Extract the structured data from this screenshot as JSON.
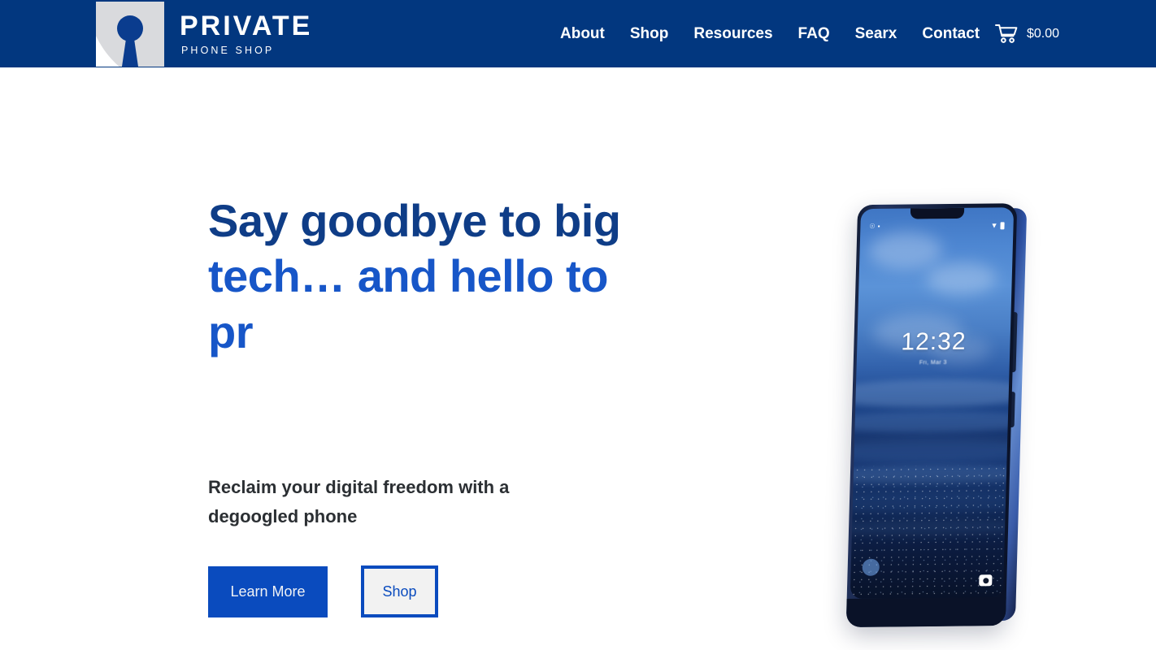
{
  "header": {
    "logo": {
      "icon": "keyhole-logo-icon",
      "title": "PRIVATE",
      "subtitle": "PHONE SHOP"
    },
    "nav": [
      {
        "label": "About"
      },
      {
        "label": "Shop"
      },
      {
        "label": "Resources"
      },
      {
        "label": "FAQ"
      },
      {
        "label": "Searx"
      },
      {
        "label": "Contact"
      }
    ],
    "cart": {
      "icon": "shopping-cart-icon",
      "total": "$0.00"
    },
    "background_color": "#02377F"
  },
  "hero": {
    "heading_line_1": "Say goodbye to big",
    "heading_line_2": "tech… and hello to pr",
    "heading_color_1": "#0F3D87",
    "heading_color_2": "#1756C8",
    "subheading": "Reclaim your digital freedom with a degoogled phone",
    "subheading_color": "#2B2F33",
    "buttons": {
      "primary_label": "Learn More",
      "primary_bg": "#0A4BBE",
      "secondary_label": "Shop",
      "secondary_bg": "#F2F2F2",
      "secondary_border": "#0A4BBE"
    },
    "phone_image": {
      "alt": "degoogled smartphone showing lock screen",
      "lock_time": "12:32",
      "lock_date": "Fri, Mar 3",
      "status_icons": [
        "notification-icon",
        "alarm-icon",
        "wifi-icon",
        "battery-icon"
      ],
      "assist_button": "assistant-shortcut-icon",
      "camera_button": "camera-shortcut-icon"
    }
  },
  "page": {
    "background_color": "#FFFFFF"
  }
}
